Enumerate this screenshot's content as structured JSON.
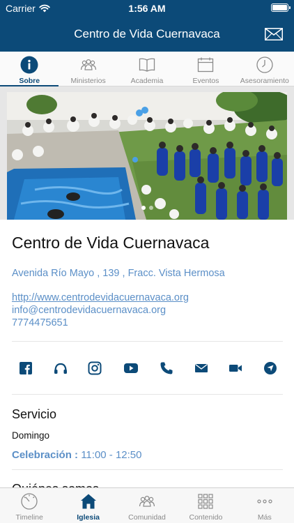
{
  "status_bar": {
    "carrier": "Carrier",
    "time": "1:56 AM"
  },
  "header": {
    "title": "Centro de Vida Cuernavaca",
    "action_icon": "mail-icon"
  },
  "tabs": [
    {
      "label": "Sobre",
      "icon": "info-icon",
      "active": true
    },
    {
      "label": "Ministerios",
      "icon": "people-group-icon",
      "active": false
    },
    {
      "label": "Academia",
      "icon": "book-icon",
      "active": false
    },
    {
      "label": "Eventos",
      "icon": "calendar-icon",
      "active": false
    },
    {
      "label": "Asesoramiento",
      "icon": "clock-icon",
      "active": false
    }
  ],
  "hero": {
    "slides": 2,
    "active_slide": 1
  },
  "church": {
    "name": "Centro de Vida Cuernavaca",
    "address": "Avenida Río Mayo , 139 , Fracc. Vista Hermosa",
    "website": "http://www.centrodevidacuernavaca.org",
    "email": "info@centrodevidacuernavaca.org",
    "phone": "7774475651"
  },
  "social_icons": [
    "facebook-icon",
    "podcast-icon",
    "instagram-icon",
    "youtube-icon",
    "phone-icon",
    "mail-icon",
    "video-icon",
    "navigation-icon"
  ],
  "service": {
    "title": "Servicio",
    "day": "Domingo",
    "name": "Celebración :",
    "hours": "11:00 - 12:50"
  },
  "about": {
    "title": "Quiénes somos"
  },
  "bottom_tabs": [
    {
      "label": "Timeline",
      "icon": "gauge-icon",
      "active": false
    },
    {
      "label": "Iglesia",
      "icon": "home-icon",
      "active": true
    },
    {
      "label": "Comunidad",
      "icon": "people-group-icon",
      "active": false
    },
    {
      "label": "Contenido",
      "icon": "grid-icon",
      "active": false
    },
    {
      "label": "Más",
      "icon": "more-icon",
      "active": false
    }
  ],
  "colors": {
    "brand": "#0c4a78",
    "link": "#5b8fc7"
  }
}
